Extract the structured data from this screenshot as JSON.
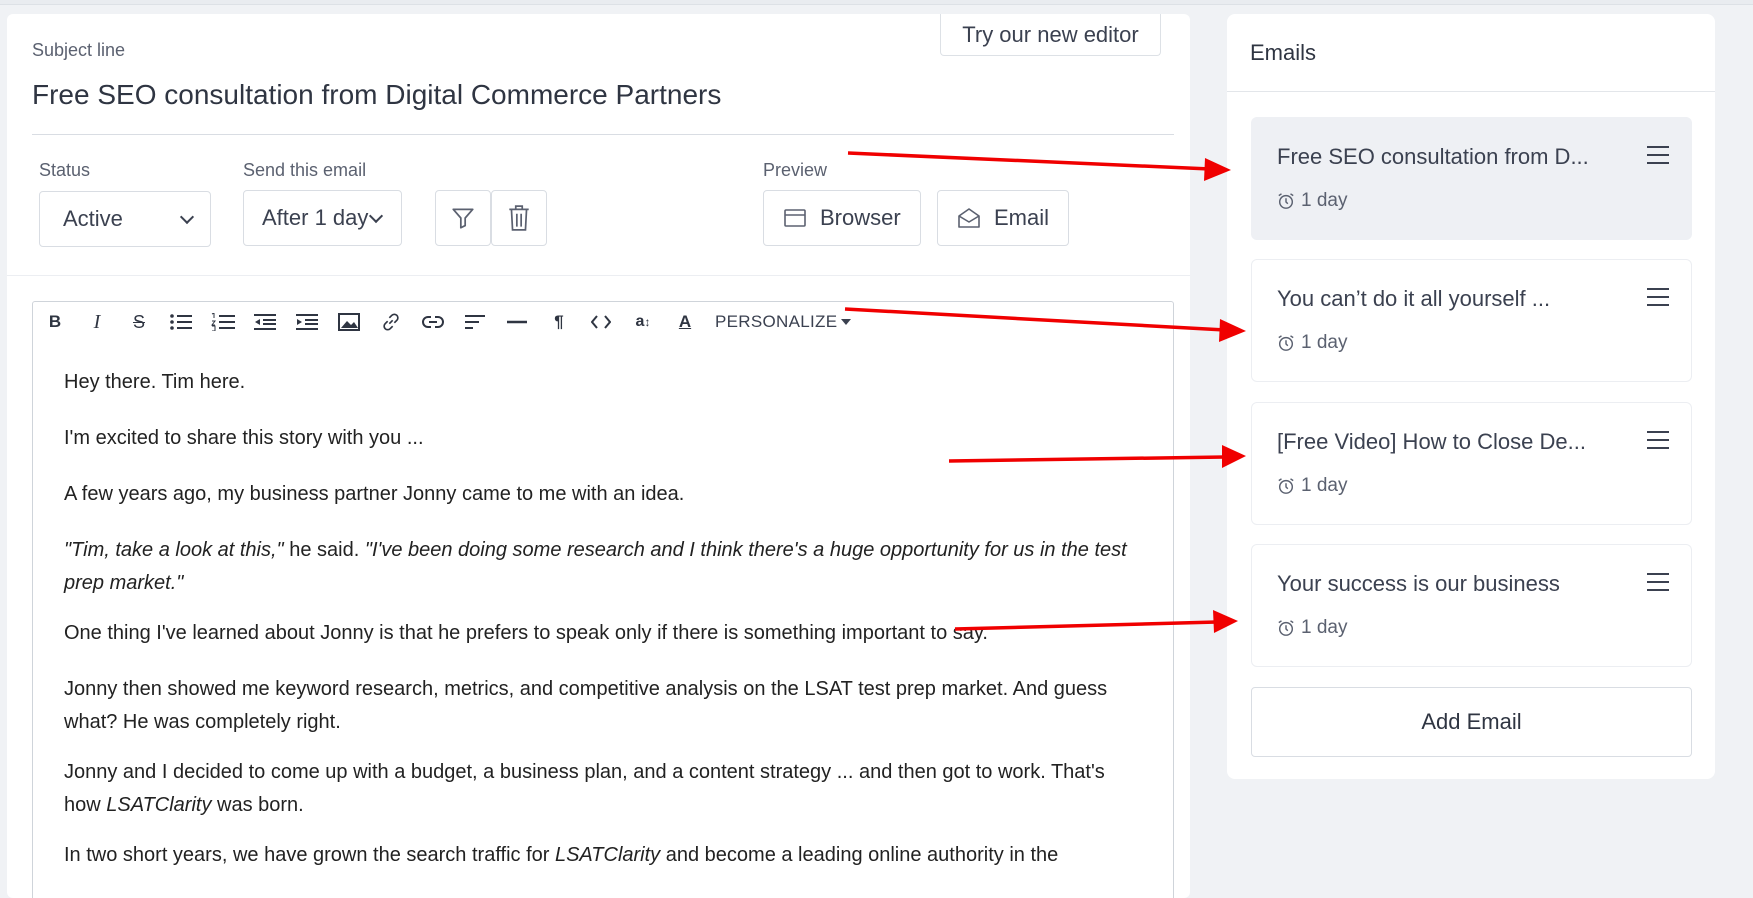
{
  "editor": {
    "try_new_editor": "Try our new editor",
    "subject_label": "Subject line",
    "subject_value": "Free SEO consultation from Digital Commerce Partners",
    "status_label": "Status",
    "status_value": "Active",
    "send_label": "Send this email",
    "send_value": "After 1 day",
    "preview_label": "Preview",
    "preview_browser": "Browser",
    "preview_email": "Email",
    "toolbar": {
      "personalize": "PERSONALIZE",
      "buttons": [
        "bold-icon",
        "italic-icon",
        "strikethrough-icon",
        "bulleted-list-icon",
        "numbered-list-icon",
        "outdent-icon",
        "indent-icon",
        "image-icon",
        "link-icon",
        "link-2-icon",
        "align-icon",
        "horizontal-rule-icon",
        "paragraph-icon",
        "code-icon",
        "font-size-icon",
        "text-color-icon"
      ]
    },
    "body": {
      "p1": "Hey there. Tim here.",
      "p2": "I'm excited to share this story with you ...",
      "p3": "A few years ago, my business partner Jonny came to me with an idea.",
      "p4_quote1": "\"Tim, take a look at this,\"",
      "p4_mid": " he said. ",
      "p4_quote2": "\"I've been doing some research and I think there's a huge opportunity for us in the test prep market.\"",
      "p5": "One thing I've learned about Jonny is that he prefers to speak only if there is something important to say.",
      "p6": "Jonny then showed me keyword research, metrics, and competitive analysis on the LSAT test prep market. And guess what? He was completely right.",
      "p7_a": "Jonny and I decided to come up with a budget, a business plan, and a content strategy ... and then got to work. That's how ",
      "p7_em": "LSATClarity",
      "p7_b": " was born.",
      "p8_a": "In two short years, we have grown the search traffic for ",
      "p8_em": "LSATClarity",
      "p8_b": " and become a leading online authority in the"
    }
  },
  "emails": {
    "header": "Emails",
    "items": [
      {
        "title": "Free SEO consultation from D...",
        "delay": "1 day"
      },
      {
        "title": "You can’t do it all yourself ...",
        "delay": "1 day"
      },
      {
        "title": "[Free Video] How to Close De...",
        "delay": "1 day"
      },
      {
        "title": "Your success is our business",
        "delay": "1 day"
      }
    ],
    "add_label": "Add Email"
  },
  "colors": {
    "annotation_arrow": "#f00000",
    "active_item_bg": "#eef0f4",
    "page_bg": "#f0f2f5"
  }
}
